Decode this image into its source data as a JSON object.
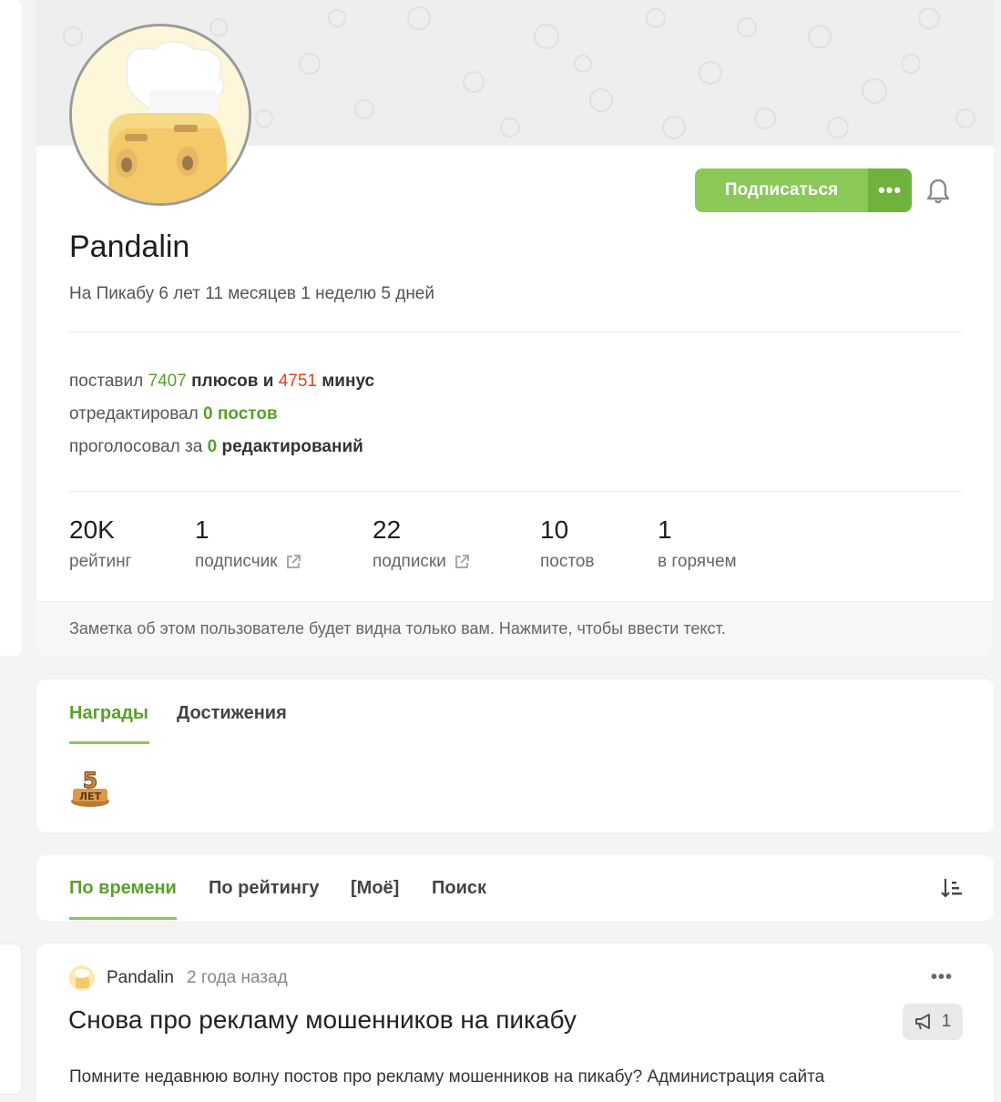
{
  "profile": {
    "username": "Pandalin",
    "since": "На Пикабу 6 лет 11 месяцев 1 неделю 5 дней",
    "subscribe_label": "Подписаться",
    "more_label": "•••",
    "stats": {
      "line1_prefix": "поставил",
      "pluses": "7407",
      "line1_mid": "плюсов и",
      "minuses": "4751",
      "line1_suffix": "минус",
      "line2_prefix": "отредактировал",
      "edited": "0 постов",
      "line3_prefix": "проголосовал за",
      "votes": "0",
      "line3_suffix": "редактирований"
    },
    "counters": [
      {
        "value": "20K",
        "label": "рейтинг"
      },
      {
        "value": "1",
        "label": "подписчик"
      },
      {
        "value": "22",
        "label": "подписки"
      },
      {
        "value": "10",
        "label": "постов"
      },
      {
        "value": "1",
        "label": "в горячем"
      }
    ],
    "note": "Заметка об этом пользователе будет видна только вам. Нажмите, чтобы ввести текст."
  },
  "awards": {
    "tabs": [
      "Награды",
      "Достижения"
    ],
    "active_tab": "Награды"
  },
  "sort_tabs": {
    "tabs": [
      "По времени",
      "По рейтингу",
      "[Моё]",
      "Поиск"
    ],
    "active_tab": "По времени"
  },
  "post": {
    "author": "Pandalin",
    "time": "2 года назад",
    "more": "•••",
    "title": "Снова про рекламу мошенников на пикабу",
    "badge_count": "1",
    "text": "Помните недавнюю волну постов про рекламу мошенников на пикабу? Администрация сайта"
  },
  "colors": {
    "accent_green": "#8ac858",
    "text_green": "#5aa02c",
    "minus_red": "#e0411f"
  }
}
